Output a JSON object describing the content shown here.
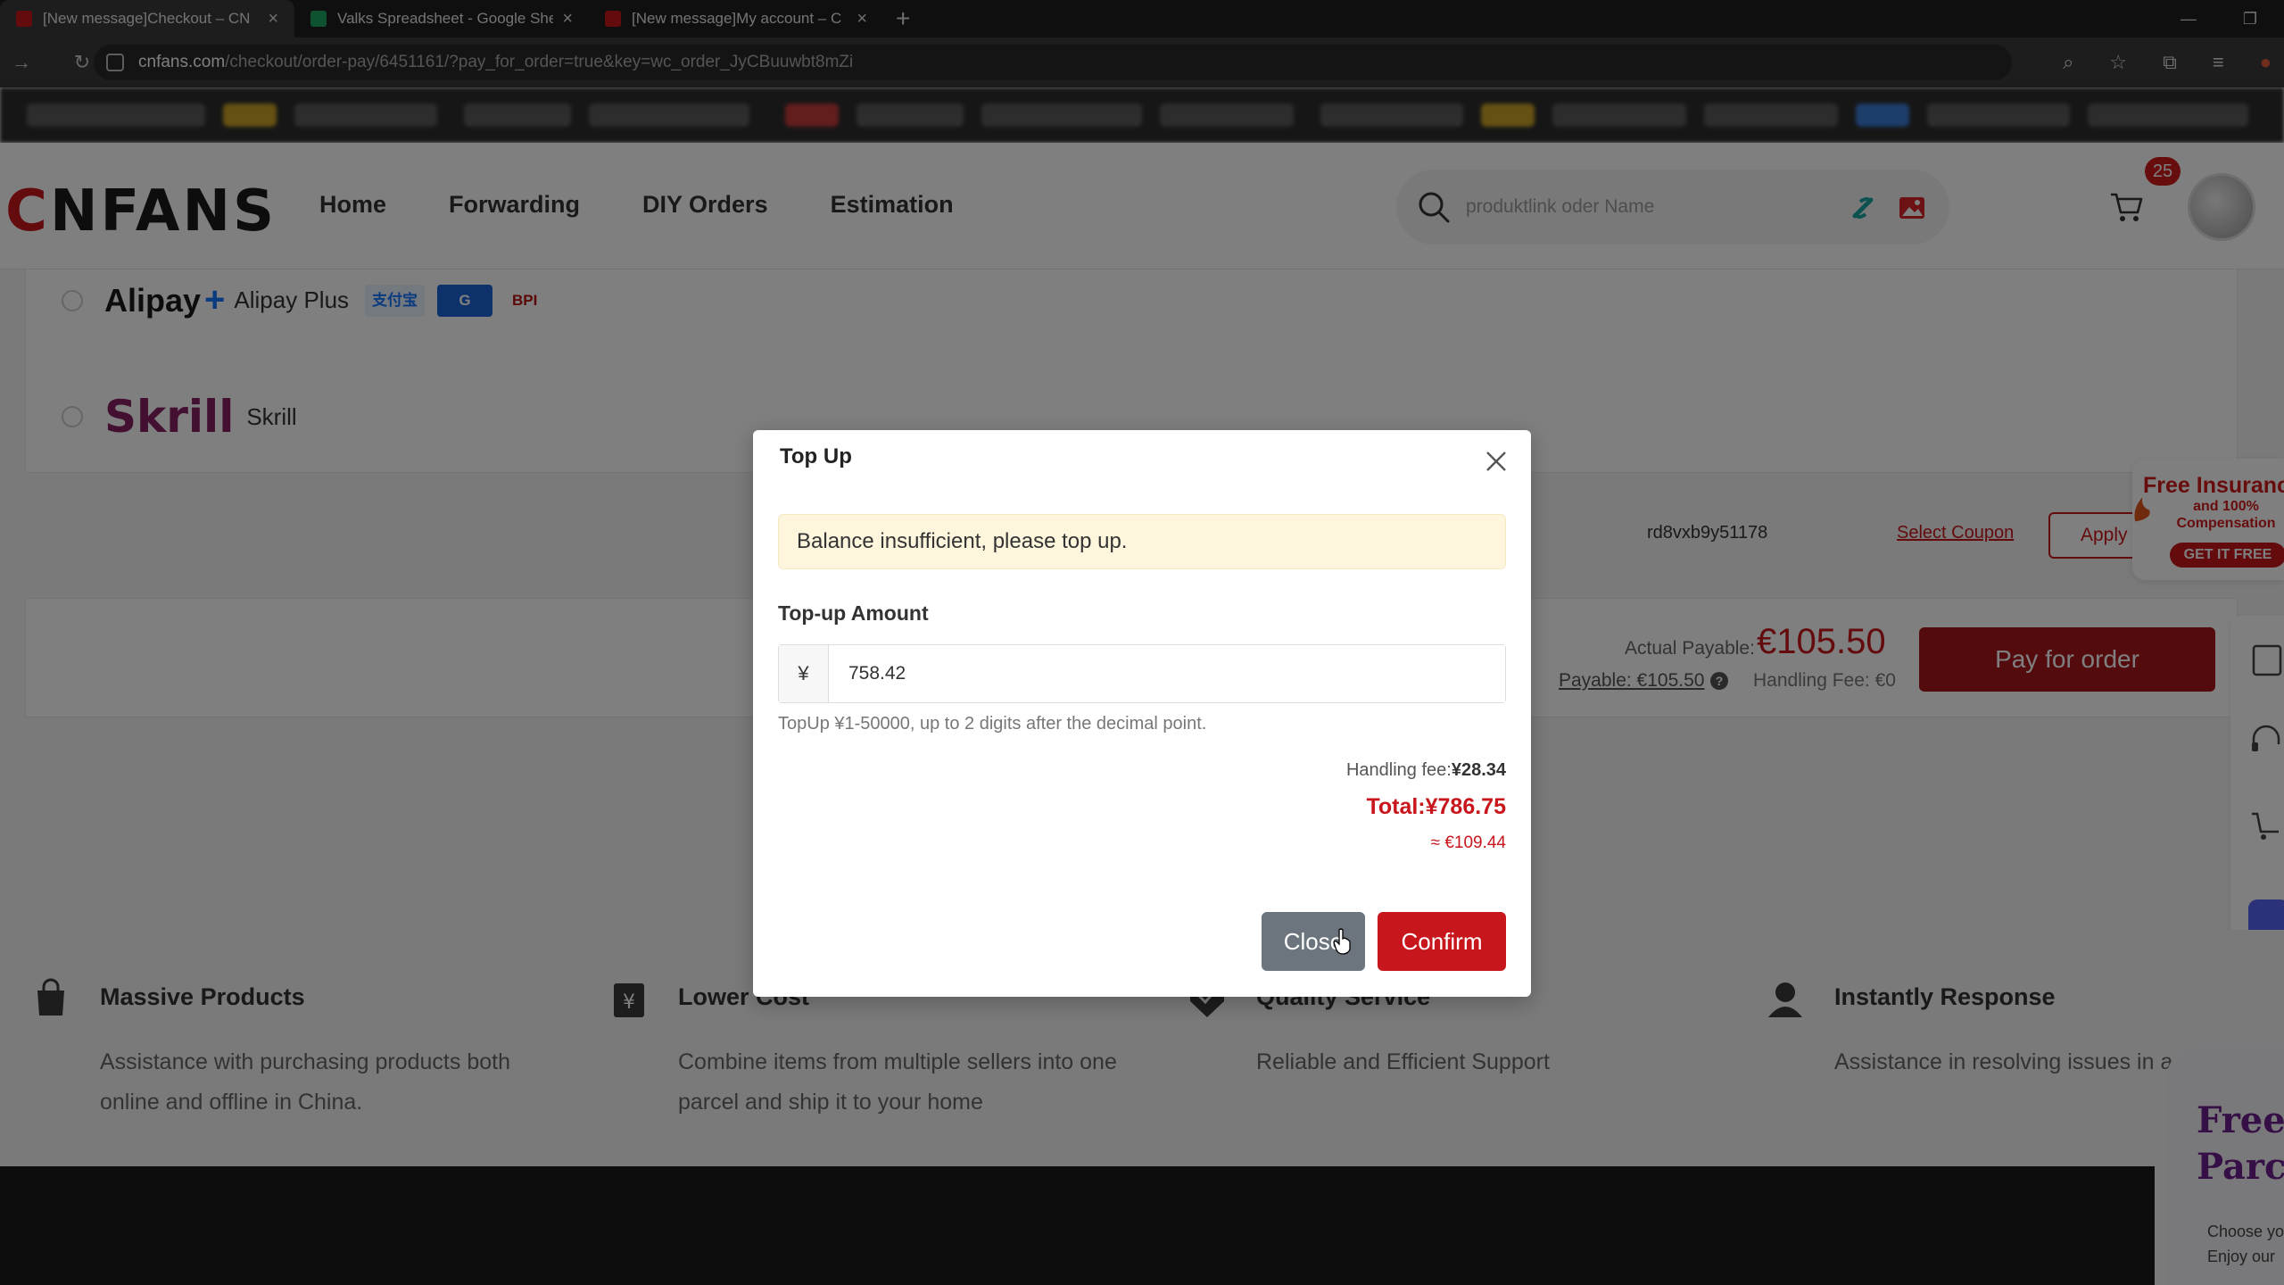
{
  "browser": {
    "tabs": [
      {
        "title": "[New message]Checkout – CN",
        "icon_color": "#c8161d",
        "active": true
      },
      {
        "title": "Valks Spreadsheet - Google She",
        "icon_color": "#1fa463",
        "active": false
      },
      {
        "title": "[New message]My account – C",
        "icon_color": "#c8161d",
        "active": false
      }
    ],
    "new_tab": "+",
    "url_host": "cnfans.com",
    "url_path": "/checkout/order-pay/6451161/?pay_for_order=true&key=wc_order_JyCBuuwbt8mZi"
  },
  "header": {
    "logo_c": "C",
    "logo_rest": "NFANS",
    "nav": [
      "Home",
      "Forwarding",
      "DIY Orders",
      "Estimation"
    ],
    "search_placeholder": "produktlink oder Name",
    "cart_count": "25"
  },
  "payment_methods": {
    "alipay_logo": "Alipay",
    "alipay_plus_symbol": "+",
    "alipay_label": "Alipay Plus",
    "badges": [
      "支付宝",
      "G",
      "BPI"
    ],
    "skrill_logo": "Skrill",
    "skrill_label": "Skrill"
  },
  "coupon": {
    "code": "rd8vxb9y51178",
    "select_label": "Select Coupon",
    "apply_label": "Apply"
  },
  "order": {
    "actual_label": "Actual Payable:",
    "actual_value": "€105.50",
    "payable_link": "Payable: €105.50",
    "handling_fee": "Handling Fee: €0",
    "pay_button": "Pay for order"
  },
  "insurance_promo": {
    "title": "Free Insurance",
    "subtitle": "and 100% Compensation",
    "button": "GET IT FREE"
  },
  "features": [
    {
      "title": "Massive Products",
      "desc": "Assistance with purchasing products both online and offline in China."
    },
    {
      "title": "Lower Cost",
      "desc": "Combine items from multiple sellers into one parcel and ship it to your home"
    },
    {
      "title": "Quality Service",
      "desc": "Reliable and Efficient Support"
    },
    {
      "title": "Instantly Response",
      "desc": "Assistance in resolving issues in a t manner."
    }
  ],
  "parcel_promo": {
    "title_1": "Free",
    "title_2": "Parce",
    "sub_1": "Choose yo",
    "sub_2": "Enjoy our"
  },
  "modal": {
    "title": "Top Up",
    "alert": "Balance insufficient, please top up.",
    "amount_label": "Top-up Amount",
    "currency_symbol": "¥",
    "amount_value": "758.42",
    "hint": "TopUp ¥1-50000, up to 2 digits after the decimal point.",
    "handling_fee_label": "Handling fee:",
    "handling_fee_value": "¥28.34",
    "total": "Total:¥786.75",
    "eur_approx": "≈ €109.44",
    "close_label": "Close",
    "confirm_label": "Confirm"
  },
  "colors": {
    "brand_red": "#c8161d",
    "pay_button": "#a6171a",
    "close_button": "#6c757d"
  }
}
